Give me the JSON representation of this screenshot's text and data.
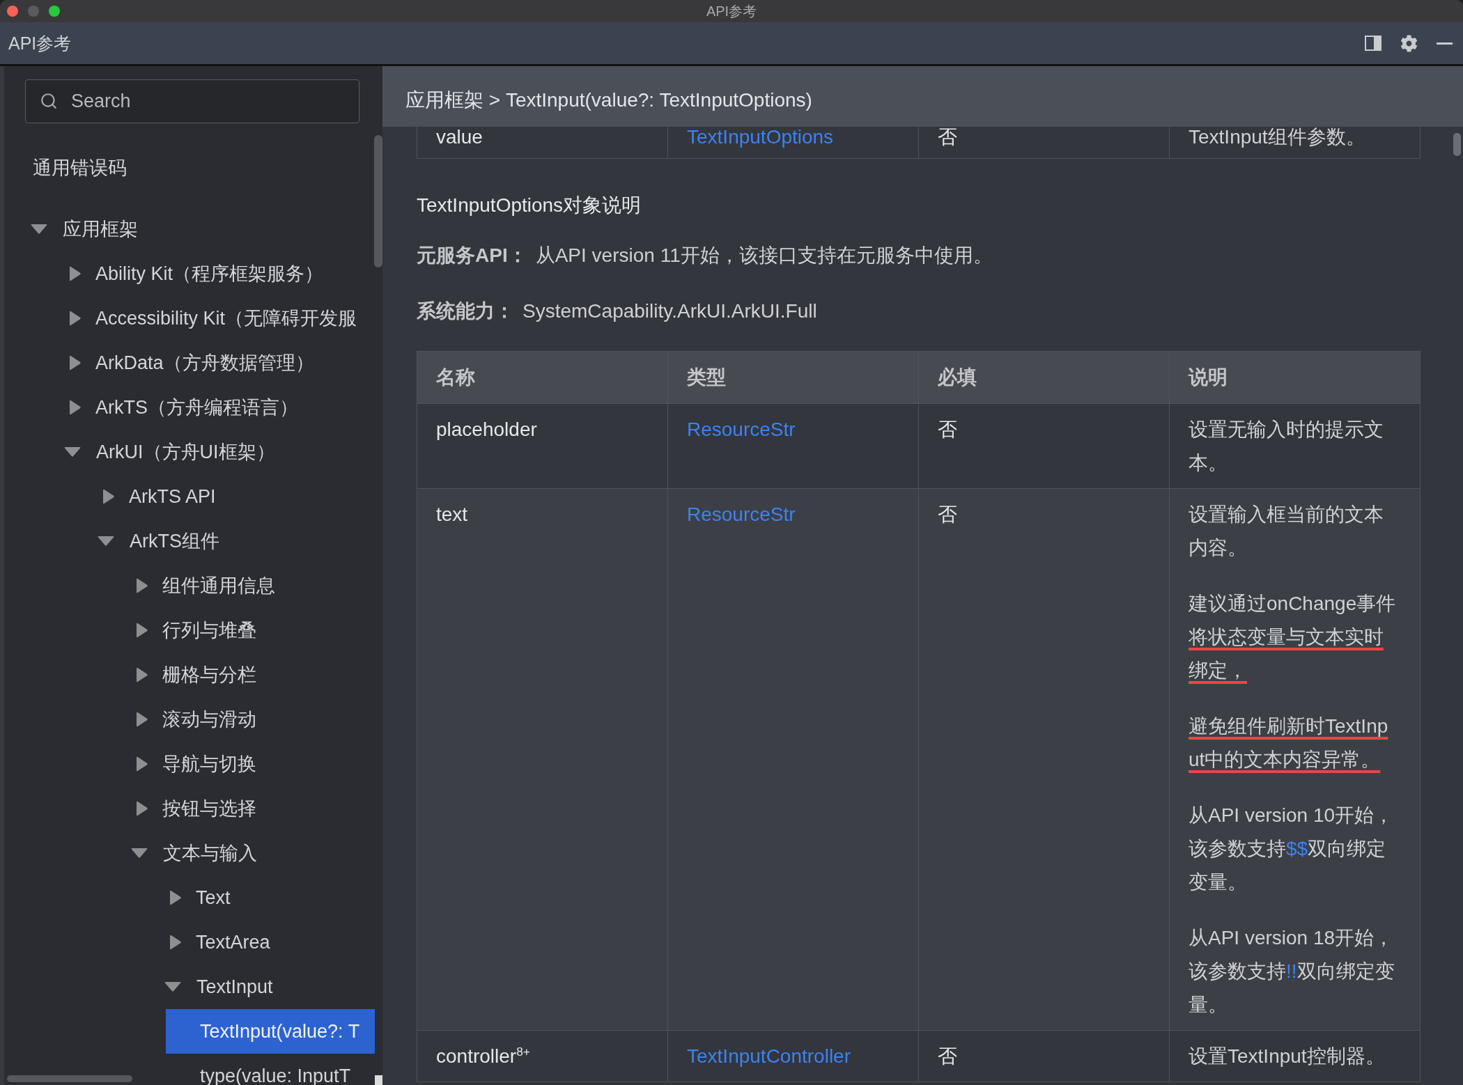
{
  "window": {
    "title": "API参考",
    "buttons": [
      {
        "kind": "close",
        "disabled": false
      },
      {
        "kind": "minimize",
        "disabled": true
      },
      {
        "kind": "zoom",
        "disabled": false
      }
    ]
  },
  "header": {
    "title": "API参考"
  },
  "sidebar": {
    "search": {
      "placeholder": "Search"
    },
    "items": [
      {
        "label": "通用错误码",
        "kind": "page",
        "selected": false
      },
      {
        "label": "应用框架",
        "kind": "folder",
        "expanded": true,
        "selected": false,
        "children": [
          {
            "label": "Ability Kit（程序框架服务）",
            "kind": "folder",
            "expanded": false,
            "selected": false
          },
          {
            "label": "Accessibility Kit（无障碍开发服",
            "kind": "folder",
            "expanded": false,
            "selected": false
          },
          {
            "label": "ArkData（方舟数据管理）",
            "kind": "folder",
            "expanded": false,
            "selected": false
          },
          {
            "label": "ArkTS（方舟编程语言）",
            "kind": "folder",
            "expanded": false,
            "selected": false
          },
          {
            "label": "ArkUI（方舟UI框架）",
            "kind": "folder",
            "expanded": true,
            "selected": false,
            "children": [
              {
                "label": "ArkTS API",
                "kind": "folder",
                "expanded": false,
                "selected": false
              },
              {
                "label": "ArkTS组件",
                "kind": "folder",
                "expanded": true,
                "selected": false,
                "children": [
                  {
                    "label": "组件通用信息",
                    "kind": "folder",
                    "expanded": false,
                    "selected": false
                  },
                  {
                    "label": "行列与堆叠",
                    "kind": "folder",
                    "expanded": false,
                    "selected": false
                  },
                  {
                    "label": "栅格与分栏",
                    "kind": "folder",
                    "expanded": false,
                    "selected": false
                  },
                  {
                    "label": "滚动与滑动",
                    "kind": "folder",
                    "expanded": false,
                    "selected": false
                  },
                  {
                    "label": "导航与切换",
                    "kind": "folder",
                    "expanded": false,
                    "selected": false
                  },
                  {
                    "label": "按钮与选择",
                    "kind": "folder",
                    "expanded": false,
                    "selected": false
                  },
                  {
                    "label": "文本与输入",
                    "kind": "folder",
                    "expanded": true,
                    "selected": false,
                    "children": [
                      {
                        "label": "Text",
                        "kind": "folder",
                        "expanded": false,
                        "selected": false
                      },
                      {
                        "label": "TextArea",
                        "kind": "folder",
                        "expanded": false,
                        "selected": false
                      },
                      {
                        "label": "TextInput",
                        "kind": "folder",
                        "expanded": true,
                        "selected": false,
                        "children": [
                          {
                            "label": "TextInput(value?: T",
                            "kind": "page",
                            "selected": true
                          },
                          {
                            "label": "type(value: InputT",
                            "kind": "page",
                            "selected": false
                          }
                        ]
                      }
                    ]
                  }
                ]
              }
            ]
          }
        ]
      }
    ]
  },
  "breadcrumb": "应用框架 > TextInput(value?: TextInputOptions)",
  "content": {
    "previous_table": {
      "rows": [
        {
          "name": "value",
          "type": "TextInputOptions",
          "required": "否",
          "description": [
            [
              {
                "text": "TextInput组件参数。",
                "kind": "plain",
                "underlined": false
              }
            ]
          ]
        }
      ]
    },
    "heading": "TextInputOptions对象说明",
    "facts": [
      {
        "label": "元服务API：",
        "value": "从API version 11开始，该接口支持在元服务中使用。"
      },
      {
        "label": "系统能力：",
        "value": "SystemCapability.ArkUI.ArkUI.Full"
      }
    ],
    "table": {
      "columns": [
        "名称",
        "类型",
        "必填",
        "说明"
      ],
      "rows": [
        {
          "name": "placeholder",
          "type": "ResourceStr",
          "required": "否",
          "description": [
            [
              {
                "text": "设置无输入时的提示文本。",
                "kind": "plain",
                "underlined": false
              }
            ]
          ]
        },
        {
          "name": "text",
          "type": "ResourceStr",
          "required": "否",
          "description": [
            [
              {
                "text": "设置输入框当前的文本内容。",
                "kind": "plain",
                "underlined": false
              }
            ],
            [
              {
                "text": "建议通过onChange事件",
                "kind": "plain",
                "underlined": false
              },
              {
                "text": "将状态变量与文本实时绑定，",
                "kind": "plain",
                "underlined": true
              }
            ],
            [
              {
                "text": "避免组件刷新时TextInput中的文本内容异常。",
                "kind": "plain",
                "underlined": true
              }
            ],
            [
              {
                "text": "从API version 10开始，该参数支持",
                "kind": "plain",
                "underlined": false
              },
              {
                "text": "$$",
                "kind": "link",
                "underlined": false
              },
              {
                "text": "双向绑定变量。",
                "kind": "plain",
                "underlined": false
              }
            ],
            [
              {
                "text": "从API version 18开始，该参数支持",
                "kind": "plain",
                "underlined": false
              },
              {
                "text": "!!",
                "kind": "link",
                "underlined": false
              },
              {
                "text": "双向绑定变量。",
                "kind": "plain",
                "underlined": false
              }
            ]
          ]
        },
        {
          "name": "controller$^{8+}$",
          "type": "TextInputController",
          "required": "否",
          "description": [
            [
              {
                "text": "设置TextInput控制器。",
                "kind": "plain",
                "underlined": false
              }
            ]
          ]
        }
      ]
    }
  }
}
